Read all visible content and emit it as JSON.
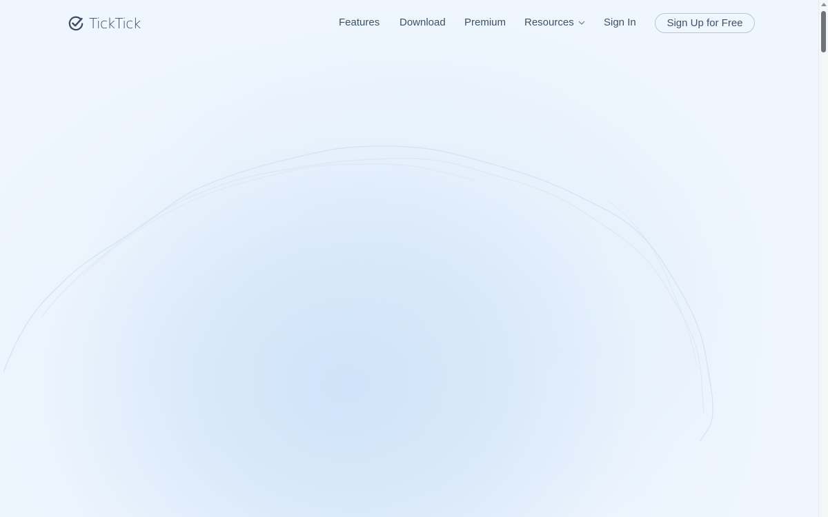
{
  "brand": {
    "name": "TickTick",
    "logo_icon": "check-circle-icon"
  },
  "nav": {
    "features": "Features",
    "download": "Download",
    "premium": "Premium",
    "resources": "Resources",
    "resources_icon": "chevron-down-icon",
    "signin": "Sign In",
    "signup": "Sign Up for Free"
  },
  "colors": {
    "background": "#eff6fd",
    "text": "#3d4f66",
    "button_border": "#b9c6d4"
  }
}
